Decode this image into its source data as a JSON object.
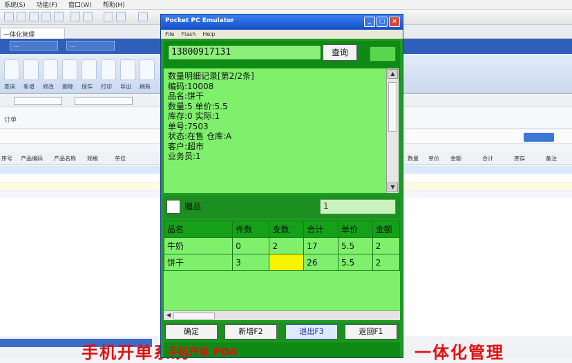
{
  "bg": {
    "menu": [
      "系统(S)",
      "功能(F)",
      "窗口(W)",
      "帮助(H)"
    ],
    "tab_label": "一体化管理",
    "nav_chips": [
      "...",
      "..."
    ],
    "ribbon_labels": [
      "查询",
      "新增",
      "修改",
      "删除",
      "保存",
      "打印",
      "导出",
      "刷新"
    ],
    "subheader_title": "订单",
    "grid_headers": [
      "序号",
      "产品编码",
      "产品名称",
      "规格",
      "单位",
      "数量",
      "单价",
      "金额",
      "合计",
      "库存",
      "备注"
    ],
    "overlay_text_left": "手机开单系统",
    "overlay_text_right": "一体化管理"
  },
  "emulator": {
    "title": "Pocket PC Emulator",
    "menu": [
      "File",
      "Flash",
      "Help"
    ],
    "close_glyph": "×",
    "min_glyph": "_",
    "max_glyph": "□"
  },
  "phone": {
    "phone_number": "13800917131",
    "query_label": "查询",
    "info_lines": [
      "数量明细记录[第2/2条]",
      "编码:10008",
      "品名:饼干",
      "数量:5      单价:5.5",
      "库存:0      实际:1",
      "单号:7503",
      "状态:在售   仓库:A",
      "客户:超市",
      "业务员:1"
    ],
    "checkbox_label": "赠品",
    "qty_value": "1",
    "grid": {
      "headers": [
        "品名",
        "件数",
        "支数",
        "合计",
        "单价",
        "金额"
      ],
      "rows": [
        [
          "牛奶",
          "0",
          "2",
          "17",
          "5.5",
          "2"
        ],
        [
          "饼干",
          "3",
          "",
          "26",
          "5.5",
          "2"
        ]
      ]
    },
    "buttons": [
      "确定",
      "新增F2",
      "退出F3",
      "返回F1"
    ],
    "bottom_text": "手机开单 PDA"
  }
}
